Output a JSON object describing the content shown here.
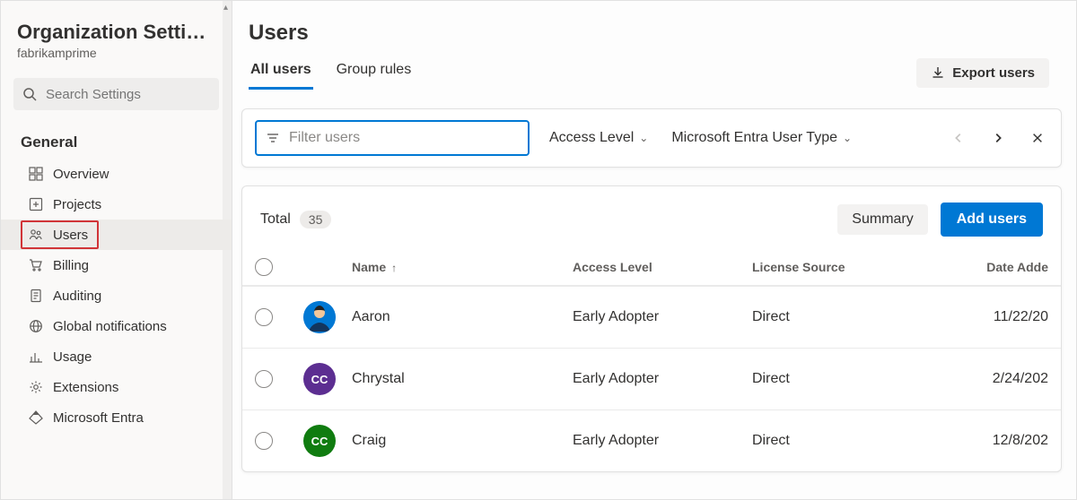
{
  "sidebar": {
    "title": "Organization Settin…",
    "subtitle": "fabrikamprime",
    "search_placeholder": "Search Settings",
    "section_label": "General",
    "items": [
      {
        "id": "overview",
        "label": "Overview"
      },
      {
        "id": "projects",
        "label": "Projects"
      },
      {
        "id": "users",
        "label": "Users"
      },
      {
        "id": "billing",
        "label": "Billing"
      },
      {
        "id": "auditing",
        "label": "Auditing"
      },
      {
        "id": "global-notifications",
        "label": "Global notifications"
      },
      {
        "id": "usage",
        "label": "Usage"
      },
      {
        "id": "extensions",
        "label": "Extensions"
      },
      {
        "id": "microsoft-entra",
        "label": "Microsoft Entra"
      }
    ]
  },
  "header": {
    "title": "Users",
    "tabs": [
      {
        "label": "All users",
        "active": true
      },
      {
        "label": "Group rules",
        "active": false
      }
    ],
    "export_label": "Export users"
  },
  "filter": {
    "placeholder": "Filter users",
    "dropdowns": [
      {
        "label": "Access Level"
      },
      {
        "label": "Microsoft Entra User Type"
      }
    ]
  },
  "table": {
    "total_label": "Total",
    "total_count": "35",
    "summary_label": "Summary",
    "add_label": "Add users",
    "columns": {
      "name": "Name",
      "access": "Access Level",
      "license": "License Source",
      "date": "Date Adde"
    },
    "rows": [
      {
        "name": "Aaron",
        "access": "Early Adopter",
        "license": "Direct",
        "date": "11/22/20",
        "avatar_kind": "svg",
        "avatar_bg": "#0078d4"
      },
      {
        "name": "Chrystal",
        "access": "Early Adopter",
        "license": "Direct",
        "date": "2/24/202",
        "avatar_kind": "initials",
        "avatar_text": "CC",
        "avatar_bg": "#5c2e91"
      },
      {
        "name": "Craig",
        "access": "Early Adopter",
        "license": "Direct",
        "date": "12/8/202",
        "avatar_kind": "initials",
        "avatar_text": "CC",
        "avatar_bg": "#107c10"
      }
    ]
  }
}
